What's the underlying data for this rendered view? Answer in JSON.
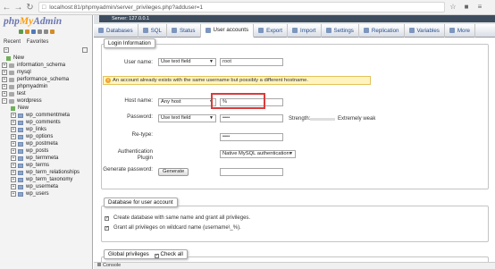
{
  "browser": {
    "url": "localhost:81/phpmyadmin/server_privileges.php?adduser=1"
  },
  "sidebar": {
    "logo_php": "php",
    "logo_my": "My",
    "logo_admin": "Admin",
    "tab_recent": "Recent",
    "tab_favorites": "Favorites",
    "tree": [
      {
        "label": "New",
        "kind": "new",
        "indent": 1
      },
      {
        "label": "information_schema",
        "kind": "db",
        "indent": 0
      },
      {
        "label": "mysql",
        "kind": "db",
        "indent": 0
      },
      {
        "label": "performance_schema",
        "kind": "db",
        "indent": 0
      },
      {
        "label": "phpmyadmin",
        "kind": "db",
        "indent": 0
      },
      {
        "label": "test",
        "kind": "db",
        "indent": 0
      },
      {
        "label": "wordpress",
        "kind": "db-open",
        "indent": 0
      },
      {
        "label": "New",
        "kind": "new",
        "indent": 2
      },
      {
        "label": "wp_commentmeta",
        "kind": "table",
        "indent": 2
      },
      {
        "label": "wp_comments",
        "kind": "table",
        "indent": 2
      },
      {
        "label": "wp_links",
        "kind": "table",
        "indent": 2
      },
      {
        "label": "wp_options",
        "kind": "table",
        "indent": 2
      },
      {
        "label": "wp_postmeta",
        "kind": "table",
        "indent": 2
      },
      {
        "label": "wp_posts",
        "kind": "table",
        "indent": 2
      },
      {
        "label": "wp_termmeta",
        "kind": "table",
        "indent": 2
      },
      {
        "label": "wp_terms",
        "kind": "table",
        "indent": 2
      },
      {
        "label": "wp_term_relationships",
        "kind": "table",
        "indent": 2
      },
      {
        "label": "wp_term_taxonomy",
        "kind": "table",
        "indent": 2
      },
      {
        "label": "wp_usermeta",
        "kind": "table",
        "indent": 2
      },
      {
        "label": "wp_users",
        "kind": "table",
        "indent": 2
      }
    ]
  },
  "header": {
    "server": "Server: 127.0.0.1"
  },
  "tabs": [
    "Databases",
    "SQL",
    "Status",
    "User accounts",
    "Export",
    "Import",
    "Settings",
    "Replication",
    "Variables",
    "More"
  ],
  "active_tab": "User accounts",
  "login": {
    "legend": "Login Information",
    "username_label": "User name:",
    "username_select": "Use text field",
    "username_value": "root",
    "warning": "An account already exists with the same username but possibly a different hostname.",
    "host_label": "Host name:",
    "host_select": "Any host",
    "host_value": "%",
    "password_label": "Password:",
    "password_select": "Use text field",
    "password_value": "••••",
    "strength_label": "Strength:",
    "strength_value": "Extremely weak",
    "retype_label": "Re-type:",
    "retype_value": "••••",
    "auth_label_1": "Authentication",
    "auth_label_2": "Plugin",
    "auth_select": "Native MySQL authentication",
    "genpass_label": "Generate password:",
    "generate_button": "Generate"
  },
  "db_for_user": {
    "legend": "Database for user account",
    "opt1": "Create database with same name and grant all privileges.",
    "opt2": "Grant all privileges on wildcard name (username\\_%)."
  },
  "global": {
    "legend": "Global privileges",
    "check_all": "Check all"
  },
  "console_label": "Console"
}
